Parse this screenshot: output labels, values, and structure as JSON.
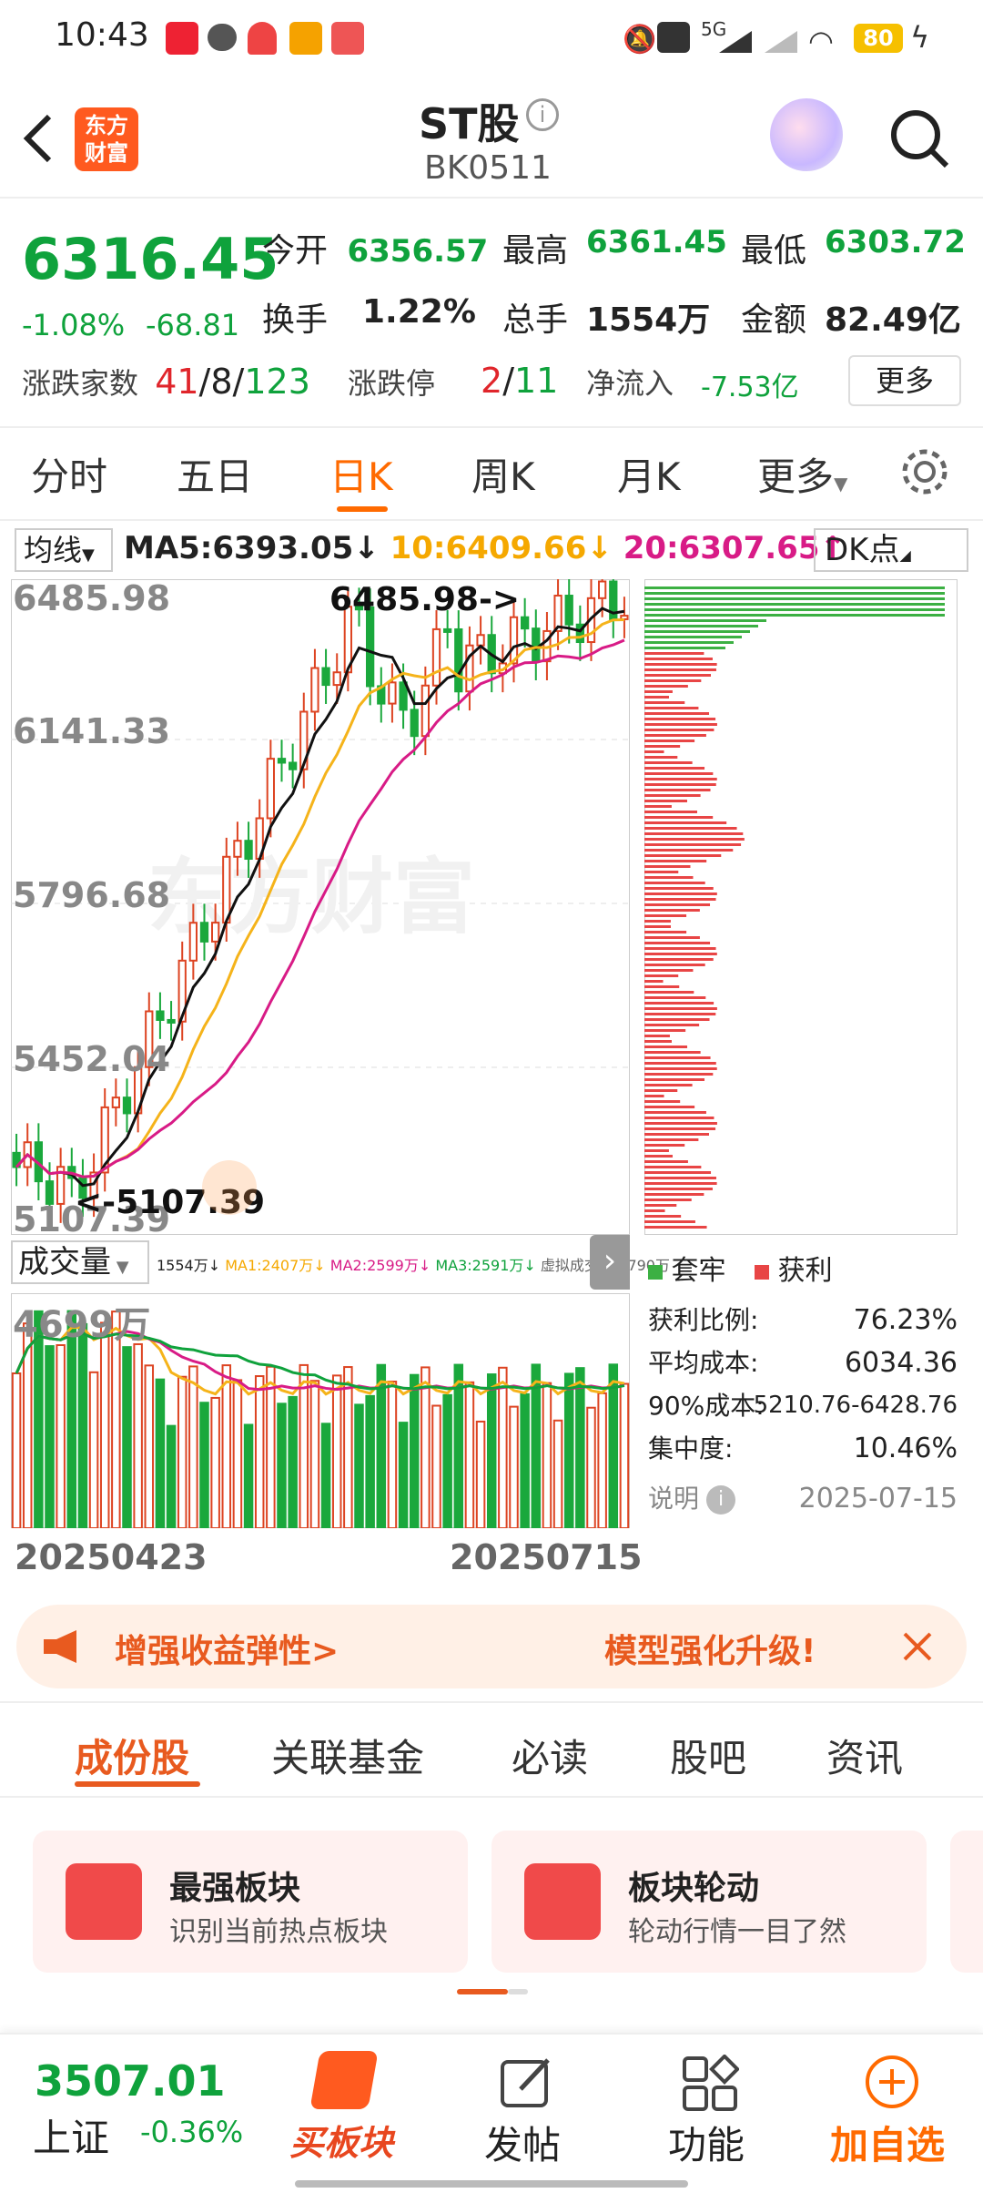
{
  "status": {
    "time": "10:43",
    "battery": "80",
    "net": "5G"
  },
  "header": {
    "title": "ST股",
    "code": "BK0511",
    "logo_line1": "东方",
    "logo_line2": "财富"
  },
  "quote": {
    "price": "6316.45",
    "pct": "-1.08%",
    "chg": "-68.81",
    "open_l": "今开",
    "open": "6356.57",
    "high_l": "最高",
    "high": "6361.45",
    "low_l": "最低",
    "low": "6303.72",
    "turn_l": "换手",
    "turn": "1.22%",
    "vol_l": "总手",
    "vol": "1554万",
    "amt_l": "金额",
    "amt": "82.49亿",
    "adv_l": "涨跌家数",
    "adv_up": "41",
    "adv_flat": "8",
    "adv_down": "123",
    "sep": "/",
    "limit_l": "涨跌停",
    "limit_up": "2",
    "limit_down": "11",
    "flow_l": "净流入",
    "flow": "-7.53亿",
    "more": "更多"
  },
  "tabs": [
    "分时",
    "五日",
    "日K",
    "周K",
    "月K",
    "更多"
  ],
  "ma": {
    "sel": "均线",
    "ma5": "MA5:6393.05↓",
    "ma10": "10:6409.66↓",
    "ma20": "20:6307.65↑",
    "dk": "DK点"
  },
  "kline": {
    "y1": "6485.98",
    "y2": "6141.33",
    "y3": "5796.68",
    "y4": "5452.04",
    "y5": "5107.39",
    "hi_mark": "6485.98->",
    "lo_mark": "<-5107.39",
    "watermark": "东方财富"
  },
  "volume": {
    "sel": "成交量",
    "legend": "1554万↓",
    "ma1": "MA1:2407万↓",
    "ma2": "MA2:2599万↓",
    "ma3": "MA3:2591万↓",
    "virt": "虚拟成交量:2790万",
    "ytop": "4699万",
    "d1": "20250423",
    "d2": "20250715"
  },
  "chips": {
    "leg_trap": "套牢",
    "leg_profit": "获利",
    "r1_l": "获利比例:",
    "r1_v": "76.23%",
    "r2_l": "平均成本:",
    "r2_v": "6034.36",
    "r3_l": "90%成本:",
    "r3_v": "5210.76-6428.76",
    "r4_l": "集中度:",
    "r4_v": "10.46%",
    "note": "说明",
    "date": "2025-07-15"
  },
  "banner": {
    "left": "增强收益弹性>",
    "right": "模型强化升级!"
  },
  "navtabs": [
    "成份股",
    "关联基金",
    "必读",
    "股吧",
    "资讯"
  ],
  "cards": [
    {
      "title": "最强板块",
      "sub": "识别当前热点板块"
    },
    {
      "title": "板块轮动",
      "sub": "轮动行情一目了然"
    }
  ],
  "bottom": {
    "index_val": "3507.01",
    "index_name": "上证",
    "index_pct": "-0.36%",
    "buy": "买板块",
    "post": "发帖",
    "func": "功能",
    "add": "加自选"
  },
  "colors": {
    "up": "#e0252b",
    "down": "#0fa23c",
    "accent": "#ff6a00"
  },
  "chart_data": {
    "type": "candlestick",
    "series": [
      {
        "name": "MA5",
        "last": 6393.05
      },
      {
        "name": "10",
        "last": 6409.66
      },
      {
        "name": "20",
        "last": 6307.65
      }
    ],
    "ylim": [
      5107.39,
      6485.98
    ],
    "x_range": [
      "20250423",
      "20250715"
    ]
  }
}
